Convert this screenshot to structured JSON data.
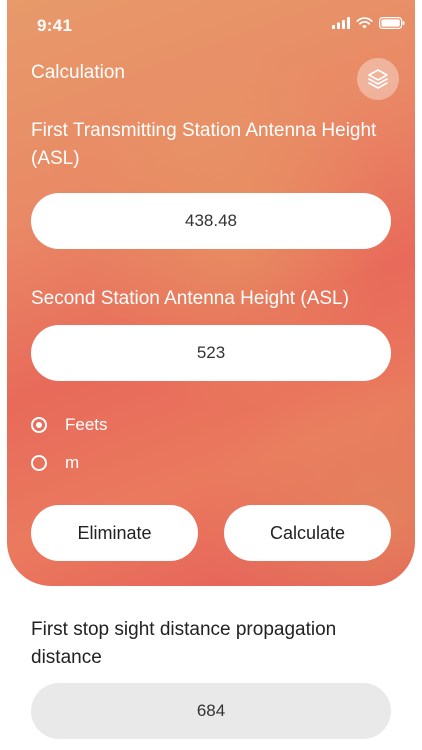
{
  "status_bar": {
    "time": "9:41"
  },
  "header": {
    "title": "Calculation",
    "layers_icon": "layers-icon"
  },
  "form": {
    "first_label": "First Transmitting Station Antenna Height (ASL)",
    "first_value": "438.48",
    "second_label": "Second Station Antenna Height (ASL)",
    "second_value": "523",
    "units": [
      {
        "label": "Feets",
        "selected": true
      },
      {
        "label": "m",
        "selected": false
      }
    ],
    "eliminate_label": "Eliminate",
    "calculate_label": "Calculate"
  },
  "result": {
    "label": "First stop sight distance propagation distance",
    "value": "684"
  },
  "colors": {
    "accent_start": "#e79a6a",
    "accent_end": "#e45a58",
    "result_bg": "#e9e9e9"
  }
}
